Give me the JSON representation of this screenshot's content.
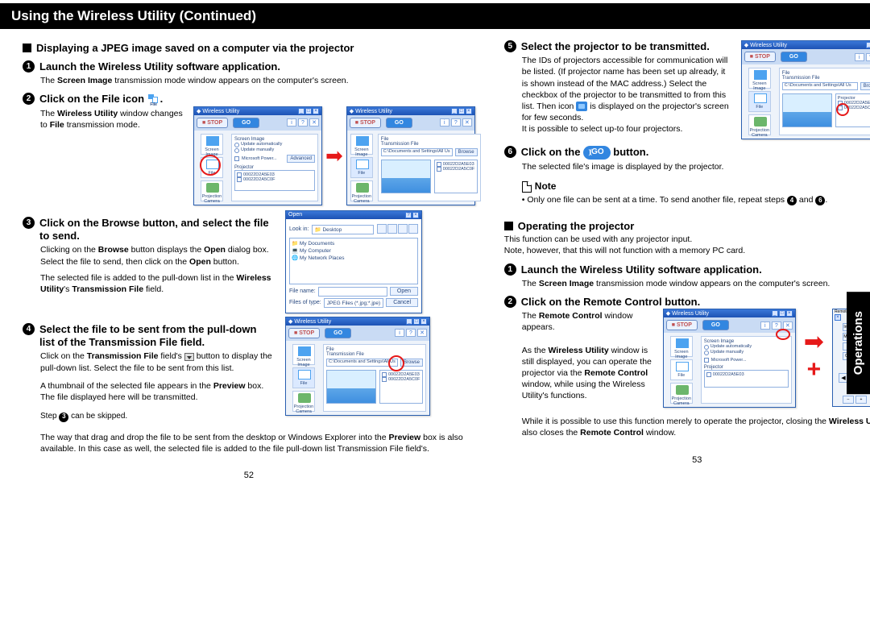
{
  "header": "Using the Wireless Utility (Continued)",
  "side_tab": "Operations",
  "page_left_num": "52",
  "page_right_num": "53",
  "left": {
    "section_title": "Displaying a JPEG image saved on a computer via the projector",
    "step1_title": "Launch the Wireless Utility software application.",
    "step1_body_a": "The ",
    "step1_body_b": "Screen Image",
    "step1_body_c": " transmission mode window appears on the computer's screen.",
    "step2_title": "Click on the File icon ",
    "step2_body_a": "The ",
    "step2_body_b": "Wireless Utility",
    "step2_body_c": " window changes to ",
    "step2_body_d": "File",
    "step2_body_e": " transmission mode.",
    "step3_title": "Click on the Browse button, and select the file to send.",
    "step3_body1_a": "Clicking on the ",
    "step3_body1_b": "Browse",
    "step3_body1_c": " button displays the ",
    "step3_body1_d": "Open",
    "step3_body1_e": " dialog box. Select the file to send, then click on the ",
    "step3_body1_f": "Open",
    "step3_body1_g": " button.",
    "step3_body2_a": "The selected file is added to the pull-down list in the ",
    "step3_body2_b": "Wireless Utility",
    "step3_body2_c": "'s ",
    "step3_body2_d": "Transmission File",
    "step3_body2_e": " field.",
    "step4_title": "Select the file to be sent from the pull-down list of the Transmission File field.",
    "step4_body1_a": "Click on the ",
    "step4_body1_b": "Transmission File",
    "step4_body1_c": " field's ",
    "step4_body1_d": " button to display the pull-down list. Select the file to be sent from this list.",
    "step4_body2_a": "A thumbnail of the selected file appears in the ",
    "step4_body2_b": "Preview",
    "step4_body2_c": " box. The file displayed here will be transmitted.",
    "step4_skip_a": "Step ",
    "step4_skip_b": " can be skipped.",
    "step4_foot_a": "The way that drag and drop the file to be sent from the desktop or Windows Explorer into the ",
    "step4_foot_b": "Preview",
    "step4_foot_c": " box is also available. In this case as well, the selected file is added to the file pull-down list Transmission File field's."
  },
  "right": {
    "step5_title": "Select the projector to be transmitted.",
    "step5_body_a": "The IDs of projectors accessible for communication will be listed. (If projector name has been set up already, it is shown instead of the MAC address.) Select the checkbox of the projector to be transmitted to from this list. Then icon ",
    "step5_body_b": " is displayed on the projector's screen for few seconds.",
    "step5_body_c": "It is possible to select up-to four projectors.",
    "step6_title_a": "Click on the ",
    "step6_title_b": " button.",
    "step6_body": "The selected file's image is displayed by the projector.",
    "note_label": "Note",
    "note_body_a": "Only one file can be sent at a time. To send another file, repeat steps ",
    "note_body_b": " and ",
    "note_body_c": ".",
    "op_title": "Operating the projector",
    "op_body1": "This function can be used with any projector input.",
    "op_body2": "Note, however, that this will not function with a memory PC card.",
    "op_step1_title": "Launch the Wireless Utility software application.",
    "op_step1_body_a": "The ",
    "op_step1_body_b": "Screen Image",
    "op_step1_body_c": " transmission mode window appears on the computer's screen.",
    "op_step2_title": "Click on the Remote Control button.",
    "op_step2_body1_a": "The ",
    "op_step2_body1_b": "Remote Control",
    "op_step2_body1_c": " window appears.",
    "op_step2_body2_a": "As the ",
    "op_step2_body2_b": "Wireless Utility",
    "op_step2_body2_c": " window is still displayed, you can operate the projector via the ",
    "op_step2_body2_d": "Remote Control",
    "op_step2_body2_e": " window, while using the Wireless Utility's functions.",
    "op_step2_foot_a": "While it is possible to use this function merely to operate the projector, closing the ",
    "op_step2_foot_b": "Wireless Utility",
    "op_step2_foot_c": " also closes the ",
    "op_step2_foot_d": "Remote Control",
    "op_step2_foot_e": " window."
  },
  "win": {
    "title": "Wireless Utility",
    "stop": "STOP",
    "go": "GO",
    "sidebar_screen": "Screen Image",
    "sidebar_file": "File",
    "sidebar_cam": "Projection Camera",
    "lbl_screen_image": "Screen Image",
    "opt_auto": "Update automatically",
    "opt_manual": "Update manually",
    "lbl_projector": "Projector",
    "app_powerpoint": "Microsoft Power...",
    "browse": "Browse",
    "advanced": "Advanced",
    "lbl_file": "File",
    "lbl_transmission": "Transmission File",
    "path1": "C:\\Documents and Settings\\All Us",
    "proj1": "00022D2A5E03",
    "proj2": "00022D2A5C0F",
    "open_title": "Open",
    "lookin": "Look in:",
    "desktop": "Desktop",
    "mydocs": "My Documents",
    "mycomp": "My Computer",
    "mynet": "My Network Places",
    "filename": "File name:",
    "filetype": "Files of type:",
    "filetype_val": "JPEG Files (*.jpg;*.jpe)",
    "open_btn": "Open",
    "cancel_btn": "Cancel",
    "remote_title": "Remote Con...",
    "rbtn_input": "Input",
    "rbtn_onoff": "On/Off",
    "rbtn_mute": "Mute",
    "rbtn_auto": "Auto set",
    "rbtn_resize": "Resize",
    "rbtn_onsc": "On Screen"
  }
}
